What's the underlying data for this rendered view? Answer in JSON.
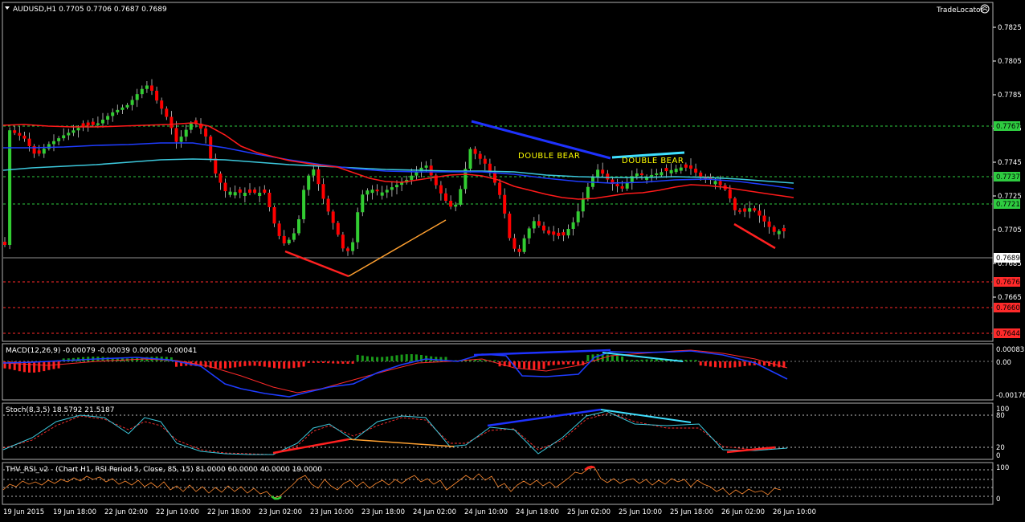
{
  "header": {
    "symbol_line": "AUDUSD,H1  0.7705 0.7706 0.7687 0.7689",
    "brand": "TradeLocator"
  },
  "price_axis": {
    "ticks": [
      "0.7825",
      "0.7805",
      "0.7785",
      "0.7765",
      "0.7745",
      "0.7725",
      "0.7705",
      "0.7685",
      "0.7665"
    ],
    "labels": [
      {
        "text": "0.7767",
        "kind": "green"
      },
      {
        "text": "0.7737",
        "kind": "green"
      },
      {
        "text": "0.7721",
        "kind": "green"
      },
      {
        "text": "0.7689",
        "kind": "white"
      },
      {
        "text": "0.7676",
        "kind": "red"
      },
      {
        "text": "0.7660",
        "kind": "red"
      },
      {
        "text": "0.7644",
        "kind": "red"
      }
    ]
  },
  "annotations": [
    "DOUBLE BEAR",
    "DOUBLE BEAR"
  ],
  "macd": {
    "title": "MACD(12,26,9) -0.00079 -0.00039 0.00000 -0.00041",
    "ticks": [
      "0.00083",
      "0.00",
      "-0.00176"
    ]
  },
  "stoch": {
    "title": "Stoch(8,3,5) 18.5792 21.5187",
    "ticks": [
      "100",
      "80",
      "20",
      "0"
    ]
  },
  "rsi": {
    "title": "THV_RSI_v2 - (Chart H1,  RSI Period 5,  Close,  85,  15)  81.0000 60.0000 40.0000 19.0000",
    "ticks": [
      "100",
      "0"
    ]
  },
  "time_axis": [
    "19 Jun 2015",
    "19 Jun 18:00",
    "22 Jun 02:00",
    "22 Jun 10:00",
    "22 Jun 18:00",
    "23 Jun 02:00",
    "23 Jun 10:00",
    "23 Jun 18:00",
    "24 Jun 02:00",
    "24 Jun 10:00",
    "24 Jun 18:00",
    "25 Jun 02:00",
    "25 Jun 10:00",
    "25 Jun 18:00",
    "26 Jun 02:00",
    "26 Jun 10:00"
  ],
  "colors": {
    "bull": "#32cd32",
    "bear": "#ff0000",
    "ma_red": "#ff1a1a",
    "ma_blue": "#1e3cff",
    "ma_cyan": "#3cc8dc",
    "trend_blue": "#1e32ff",
    "trend_cyan": "#40e0ff",
    "trend_red": "#ff2020",
    "trend_orange": "#ffa030",
    "grid": "#c0c0c0",
    "level_green": "#2ecc40",
    "level_red": "#ff2a2a",
    "annotation": "#ffff00"
  }
}
